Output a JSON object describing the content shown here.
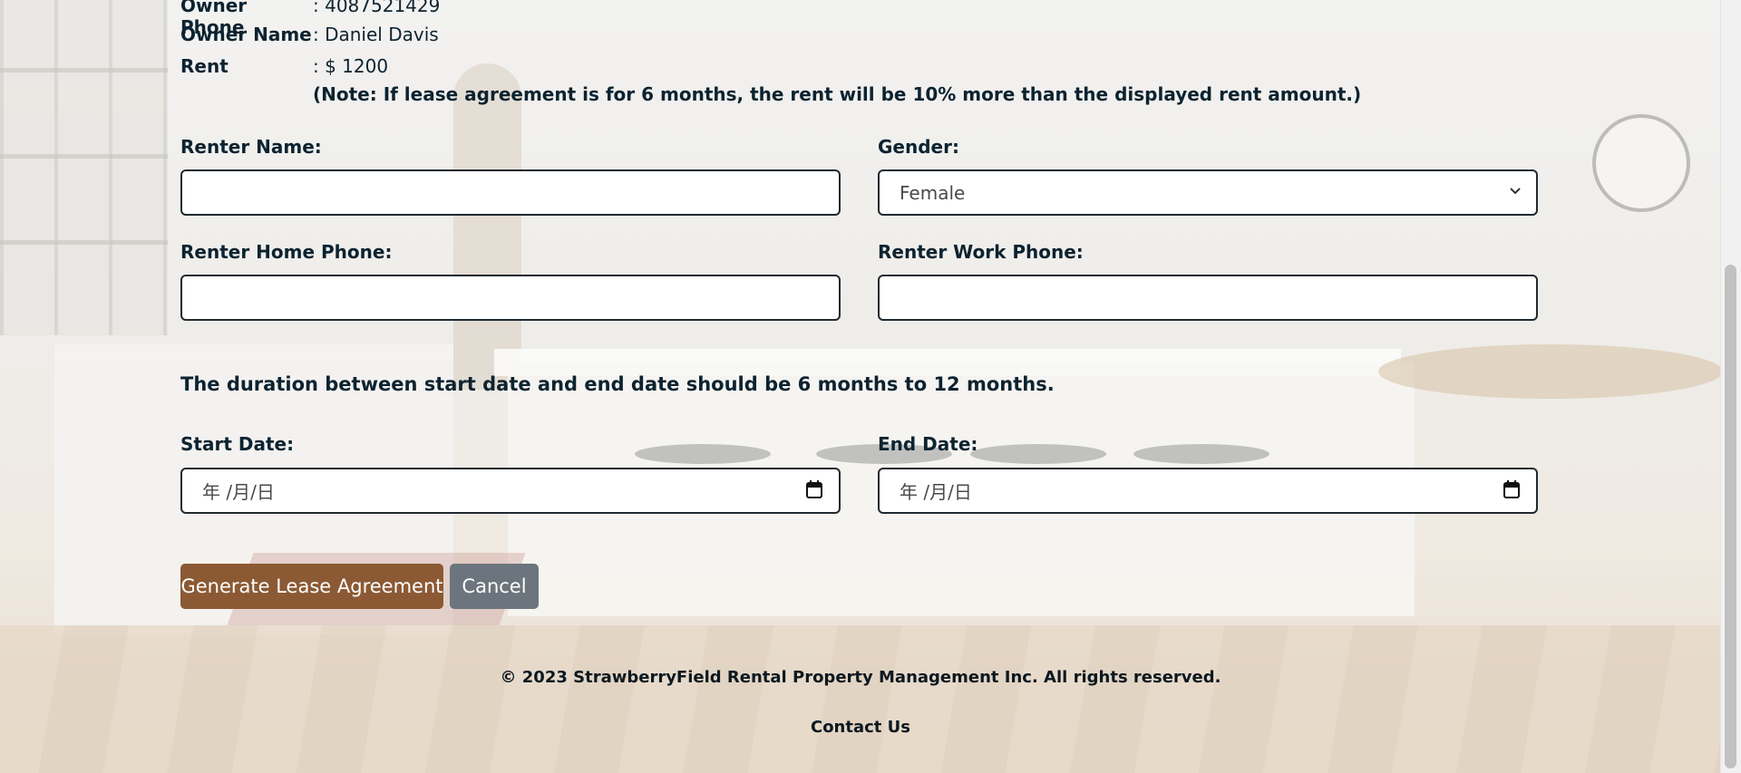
{
  "owner": {
    "phone_label": "Owner Phone",
    "phone_value": ": 4087521429",
    "name_label": "Owner Name",
    "name_value": ": Daniel Davis",
    "rent_label": "Rent",
    "rent_value": ": $ 1200",
    "note": "(Note: If lease agreement is for 6 months, the rent will be 10% more than the displayed rent amount.)"
  },
  "form": {
    "renter_name_label": "Renter Name:",
    "renter_name_value": "",
    "gender_label": "Gender:",
    "gender_selected": "Female",
    "home_phone_label": "Renter Home Phone:",
    "home_phone_value": "",
    "work_phone_label": "Renter Work Phone:",
    "work_phone_value": "",
    "duration_note": "The duration between start date and end date should be 6 months to 12 months.",
    "start_date_label": "Start Date:",
    "start_date_placeholder": "年 /月/日",
    "end_date_label": "End Date:",
    "end_date_placeholder": "年 /月/日"
  },
  "buttons": {
    "generate": "Generate Lease Agreement",
    "cancel": "Cancel"
  },
  "footer": {
    "copyright": "© 2023 StrawberryField Rental Property Management Inc. All rights reserved.",
    "contact": "Contact Us"
  },
  "colors": {
    "primary_button": "#8b5a34",
    "cancel_button": "#6c757d",
    "text": "#0c2330"
  }
}
